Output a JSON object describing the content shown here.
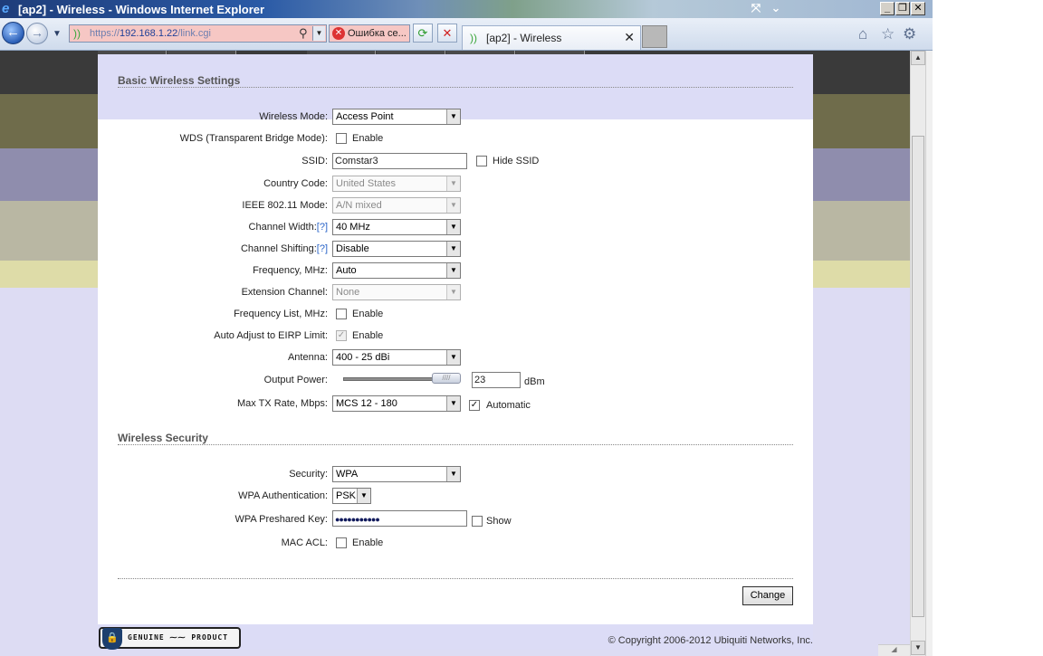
{
  "window": {
    "title": "[ap2] - Wireless - Windows Internet Explorer",
    "minimize": "_",
    "restore": "❐",
    "close": "✕"
  },
  "browser": {
    "url_prefix": "https://",
    "url_host": "192.168.1.22",
    "url_path": "/link.cgi",
    "cert_error": "Ошибка се...",
    "tab_title": "[ap2] - Wireless",
    "tab_close": "✕"
  },
  "basic": {
    "title": "Basic Wireless Settings",
    "wireless_mode": {
      "label": "Wireless Mode:",
      "value": "Access Point"
    },
    "wds": {
      "label": "WDS (Transparent Bridge Mode):",
      "option": "Enable",
      "checked": false
    },
    "ssid": {
      "label": "SSID:",
      "value": "Comstar3",
      "hide_label": "Hide SSID",
      "hide_checked": false
    },
    "country": {
      "label": "Country Code:",
      "value": "United States"
    },
    "ieee": {
      "label": "IEEE 802.11 Mode:",
      "value": "A/N mixed"
    },
    "channel_width": {
      "label": "Channel Width:",
      "help": "[?]",
      "value": "40 MHz"
    },
    "channel_shifting": {
      "label": "Channel Shifting:",
      "help": "[?]",
      "value": "Disable"
    },
    "frequency": {
      "label": "Frequency, MHz:",
      "value": "Auto"
    },
    "extension_channel": {
      "label": "Extension Channel:",
      "value": "None"
    },
    "frequency_list": {
      "label": "Frequency List, MHz:",
      "option": "Enable",
      "checked": false
    },
    "auto_adjust": {
      "label": "Auto Adjust to EIRP Limit:",
      "option": "Enable",
      "checked": true
    },
    "antenna": {
      "label": "Antenna:",
      "value": "400 - 25 dBi"
    },
    "output_power": {
      "label": "Output Power:",
      "value": "23",
      "unit": "dBm",
      "level": 1.0
    },
    "max_tx": {
      "label": "Max TX Rate, Mbps:",
      "value": "MCS 12 - 180",
      "auto_label": "Automatic",
      "auto_checked": true
    }
  },
  "security": {
    "title": "Wireless Security",
    "security": {
      "label": "Security:",
      "value": "WPA"
    },
    "wpa_auth": {
      "label": "WPA Authentication:",
      "value": "PSK"
    },
    "wpa_key": {
      "label": "WPA Preshared Key:",
      "value": "●●●●●●●●●●●",
      "show_label": "Show",
      "show_checked": false
    },
    "mac_acl": {
      "label": "MAC ACL:",
      "option": "Enable",
      "checked": false
    }
  },
  "actions": {
    "change": "Change"
  },
  "footer": {
    "badge_text": "GENUINE ⁓⁓ PRODUCT",
    "copyright": "© Copyright 2006-2012 Ubiquiti Networks, Inc."
  }
}
